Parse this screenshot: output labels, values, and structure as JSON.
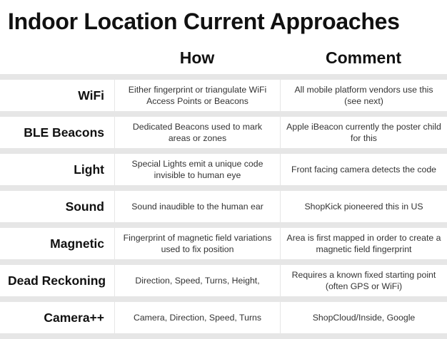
{
  "title": "Indoor Location Current Approaches",
  "headers": {
    "how": "How",
    "comment": "Comment"
  },
  "rows": [
    {
      "label": "WiFi",
      "how": "Either fingerprint or triangulate WiFi Access Points or Beacons",
      "comment": "All mobile platform vendors use this (see next)"
    },
    {
      "label": "BLE Beacons",
      "how": "Dedicated Beacons used to mark areas or zones",
      "comment": "Apple iBeacon currently the poster child for this"
    },
    {
      "label": "Light",
      "how": "Special Lights emit a unique code invisible to human eye",
      "comment": "Front facing camera detects the code"
    },
    {
      "label": "Sound",
      "how": "Sound inaudible to the human ear",
      "comment": "ShopKick pioneered this in US"
    },
    {
      "label": "Magnetic",
      "how": "Fingerprint of magnetic field variations used to fix position",
      "comment": "Area is first mapped in order to create a magnetic field fingerprint"
    },
    {
      "label": "Dead Reckoning",
      "how": "Direction, Speed, Turns, Height,",
      "comment": "Requires a known fixed starting point (often GPS or WiFi)"
    },
    {
      "label": "Camera++",
      "how": "Camera, Direction, Speed, Turns",
      "comment": "ShopCloud/Inside, Google"
    }
  ]
}
